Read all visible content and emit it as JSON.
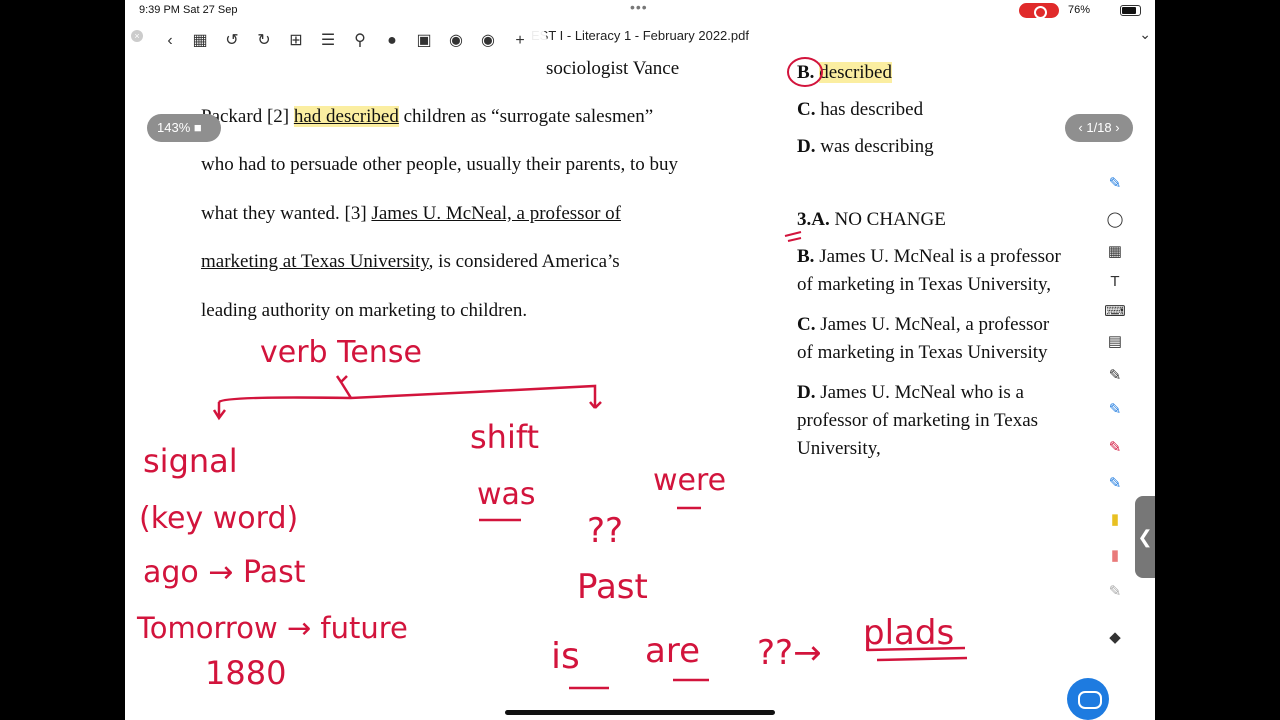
{
  "status": {
    "time_date": "9:39 PM  Sat 27 Sep",
    "dots": "•••",
    "battery_text": "76%"
  },
  "titlebar": {
    "title": "EST I - Literacy 1 - February 2022.pdf",
    "chevron": "⌄",
    "close": "×"
  },
  "zoom": "143%",
  "pager": {
    "prev": "‹",
    "text": "1/18",
    "next": "›"
  },
  "passage": {
    "line1_end": "sociologist Vance",
    "line2": {
      "start": "Packard [2] ",
      "underlined": "had described",
      "end": " children as “surrogate salesmen”"
    },
    "line3": "who had to persuade other people, usually their parents, to buy",
    "line4": {
      "start": "what they wanted. [3] ",
      "underlined": "James U. McNeal, a professor of"
    },
    "line5": {
      "underlined": "marketing at Texas University",
      "end": ", is considered America’s"
    },
    "line6": "leading authority on marketing to children."
  },
  "answers": {
    "q2": {
      "b_letter": "B.",
      "b_text": "described",
      "c_letter": "C.",
      "c_text": "has described",
      "d_letter": "D.",
      "d_text": "was describing"
    },
    "q3": {
      "header": "3.A.",
      "a_text": "NO CHANGE",
      "b_letter": "B.",
      "b_line1": "James U. McNeal is a professor",
      "b_line2": "of marketing in Texas University,",
      "c_letter": "C.",
      "c_line1": "James U. McNeal, a professor",
      "c_line2": "of marketing in Texas University",
      "d_letter": "D.",
      "d_line1": "James U. McNeal who is a",
      "d_line2": "professor of marketing in Texas",
      "d_line3": "University,"
    }
  },
  "handwriting": {
    "verb_tense": "verb  Tense",
    "signal": "signal",
    "keyword": "(key word)",
    "ago_past": "ago → Past",
    "tomorrow_future": "Tomorrow → future",
    "year": "1880",
    "shift": "shift",
    "was": "was",
    "were": "were",
    "question": "??",
    "past": "Past",
    "is": "is",
    "are": "are",
    "question2": "??→",
    "plads": "plads"
  },
  "colors": {
    "ink": "#d2143c",
    "highlight": "#fbeea1",
    "accent": "#1e7be0"
  }
}
